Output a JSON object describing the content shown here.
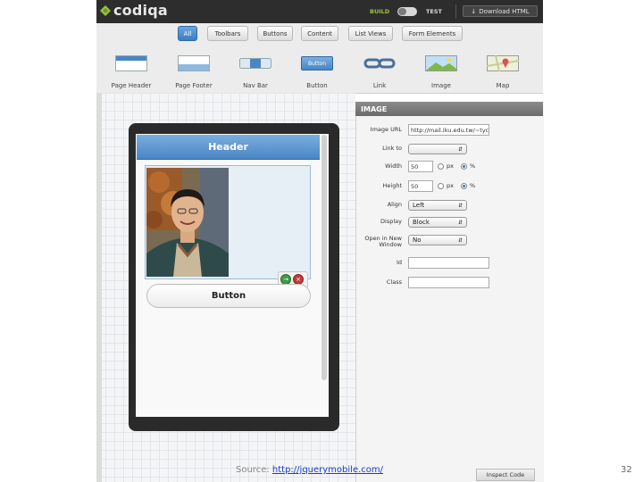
{
  "app": {
    "logo_text": "codiqa",
    "build_label": "BUILD",
    "test_label": "TEST",
    "download_label": "Download HTML"
  },
  "tabs": [
    {
      "label": "All",
      "active": true
    },
    {
      "label": "Toolbars",
      "active": false
    },
    {
      "label": "Buttons",
      "active": false
    },
    {
      "label": "Content",
      "active": false
    },
    {
      "label": "List Views",
      "active": false
    },
    {
      "label": "Form Elements",
      "active": false
    }
  ],
  "components": [
    {
      "label": "Page Header",
      "icon": "page-header-icon"
    },
    {
      "label": "Page Footer",
      "icon": "page-footer-icon"
    },
    {
      "label": "Nav Bar",
      "icon": "nav-bar-icon"
    },
    {
      "label": "Button",
      "icon": "button-component-icon"
    },
    {
      "label": "Link",
      "icon": "link-chain-icon"
    },
    {
      "label": "Image",
      "icon": "image-landscape-icon"
    },
    {
      "label": "Map",
      "icon": "map-pin-icon"
    }
  ],
  "preview": {
    "header": "Header",
    "button": "Button",
    "button_icon_text": "Button"
  },
  "panel": {
    "title": "IMAGE",
    "image_url_label": "Image URL",
    "image_url_value": "http://mail.iku.edu.tw/~tyc",
    "link_to_label": "Link to",
    "link_to_value": "",
    "width_label": "Width",
    "width_value": "50",
    "height_label": "Height",
    "height_value": "50",
    "unit_px": "px",
    "unit_pct": "%",
    "align_label": "Align",
    "align_value": "Left",
    "display_label": "Display",
    "display_value": "Block",
    "open_new_label": "Open in New Window",
    "open_new_value": "No",
    "id_label": "Id",
    "class_label": "Class",
    "inspect_label": "Inspect Code"
  },
  "footer": {
    "source_prefix": "Source: ",
    "source_link": "http://jquerymobile.com/",
    "page_number": "32"
  },
  "colors": {
    "accent_blue": "#4a86c4",
    "logo_green": "#9cc33b",
    "topbar": "#2d2d2d"
  }
}
